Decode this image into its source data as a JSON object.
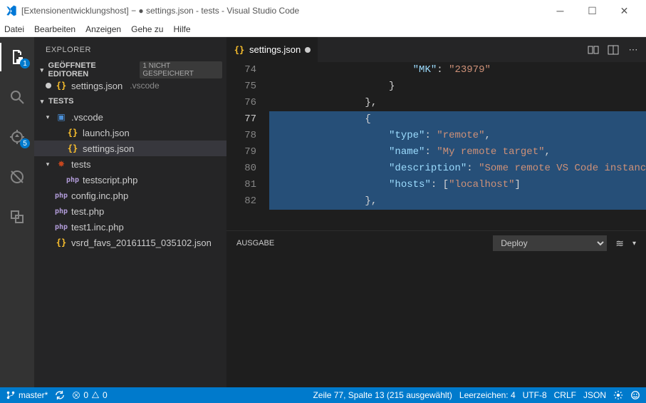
{
  "window": {
    "title": "[Extensionentwicklungshost] − ● settings.json - tests - Visual Studio Code"
  },
  "menu": {
    "items": [
      "Datei",
      "Bearbeiten",
      "Anzeigen",
      "Gehe zu",
      "Hilfe"
    ]
  },
  "activity": {
    "explorer_badge": "1",
    "debug_badge": "5"
  },
  "sidebar": {
    "title": "EXPLORER",
    "open_editors": {
      "header": "GEÖFFNETE EDITOREN",
      "unsaved_label": "1 NICHT GESPEICHERT",
      "entries": [
        {
          "name": "settings.json",
          "subdir": ".vscode",
          "dirty": true
        }
      ]
    },
    "workspace": {
      "header": "TESTS",
      "tree": [
        {
          "kind": "folder",
          "name": ".vscode",
          "depth": 1,
          "expanded": true,
          "icon": "vscode-folder"
        },
        {
          "kind": "file",
          "name": "launch.json",
          "depth": 2,
          "icon": "json"
        },
        {
          "kind": "file",
          "name": "settings.json",
          "depth": 2,
          "icon": "json",
          "selected": true
        },
        {
          "kind": "folder",
          "name": "tests",
          "depth": 1,
          "expanded": true,
          "icon": "bug-folder"
        },
        {
          "kind": "file",
          "name": "testscript.php",
          "depth": 2,
          "icon": "php"
        },
        {
          "kind": "file",
          "name": "config.inc.php",
          "depth": 1,
          "icon": "php"
        },
        {
          "kind": "file",
          "name": "test.php",
          "depth": 1,
          "icon": "php"
        },
        {
          "kind": "file",
          "name": "test1.inc.php",
          "depth": 1,
          "icon": "php"
        },
        {
          "kind": "file",
          "name": "vsrd_favs_20161115_035102.json",
          "depth": 1,
          "icon": "json"
        }
      ]
    }
  },
  "editor": {
    "tab": {
      "name": "settings.json",
      "dirty": true
    },
    "gutter": [
      "74",
      "75",
      "76",
      "77",
      "78",
      "79",
      "80",
      "81",
      "82"
    ],
    "current_line_index": 3,
    "selection_rows": [
      3,
      4,
      5,
      6,
      7,
      8
    ],
    "lines": [
      {
        "indent": 24,
        "segments": [
          [
            "key",
            "\"MK\""
          ],
          [
            "pun",
            ": "
          ],
          [
            "str",
            "\"23979\""
          ]
        ]
      },
      {
        "indent": 20,
        "segments": [
          [
            "pun",
            "}"
          ]
        ]
      },
      {
        "indent": 16,
        "segments": [
          [
            "pun",
            "},"
          ]
        ]
      },
      {
        "indent": 16,
        "segments": [
          [
            "pun",
            "{"
          ]
        ]
      },
      {
        "indent": 20,
        "segments": [
          [
            "key",
            "\"type\""
          ],
          [
            "pun",
            ": "
          ],
          [
            "str",
            "\"remote\""
          ],
          [
            "pun",
            ","
          ]
        ]
      },
      {
        "indent": 20,
        "segments": [
          [
            "key",
            "\"name\""
          ],
          [
            "pun",
            ": "
          ],
          [
            "str",
            "\"My remote target\""
          ],
          [
            "pun",
            ","
          ]
        ]
      },
      {
        "indent": 20,
        "segments": [
          [
            "key",
            "\"description\""
          ],
          [
            "pun",
            ": "
          ],
          [
            "str",
            "\"Some remote VS Code instances"
          ]
        ]
      },
      {
        "indent": 20,
        "segments": [
          [
            "key",
            "\"hosts\""
          ],
          [
            "pun",
            ": ["
          ],
          [
            "str",
            "\"localhost\""
          ],
          [
            "pun",
            "]"
          ]
        ]
      },
      {
        "indent": 16,
        "segments": [
          [
            "pun",
            "},"
          ]
        ]
      }
    ]
  },
  "panel": {
    "title": "AUSGABE",
    "channel_selected": "Deploy"
  },
  "status": {
    "branch": "master*",
    "errors": "0",
    "warnings": "0",
    "cursor": "Zeile 77, Spalte 13 (215 ausgewählt)",
    "indent": "Leerzeichen: 4",
    "encoding": "UTF-8",
    "eol": "CRLF",
    "language": "JSON"
  }
}
